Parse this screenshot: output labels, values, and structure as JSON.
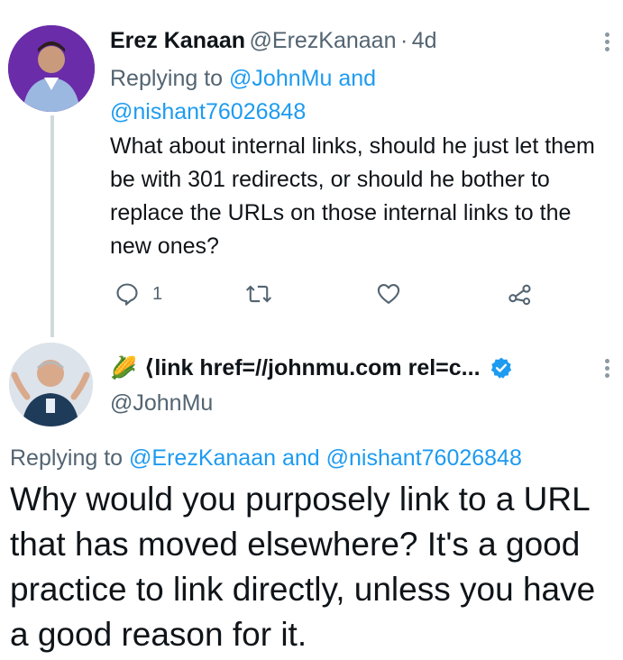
{
  "tweet1": {
    "author_name": "Erez Kanaan",
    "handle": "@ErezKanaan",
    "separator": "·",
    "time": "4d",
    "replying_prefix": "Replying to",
    "replying_to_1": "@JohnMu",
    "replying_and": "and",
    "replying_to_2": "@nishant76026848",
    "text": "What about internal links, should he just let them be with 301 redirects, or should he bother to replace the URLs on those internal links to the new ones?",
    "reply_count": "1"
  },
  "tweet2": {
    "emoji": "🌽",
    "author_name": "⟨link href=//johnmu.com rel=c...",
    "handle": "@JohnMu",
    "replying_prefix": "Replying to",
    "replying_to_1": "@ErezKanaan",
    "replying_and": "and",
    "replying_to_2": "@nishant76026848",
    "text": "Why would you purposely link to a URL that has moved elsewhere? It's a good practice to link directly, unless you have a good reason for it."
  },
  "colors": {
    "accent": "#1d9bf0",
    "muted": "#536471",
    "thread_line": "#cfd9de",
    "avatar1_bg": "#6a2ca8"
  },
  "icons": [
    "reply-icon",
    "retweet-icon",
    "like-icon",
    "share-icon",
    "more-icon",
    "verified-badge-icon"
  ]
}
